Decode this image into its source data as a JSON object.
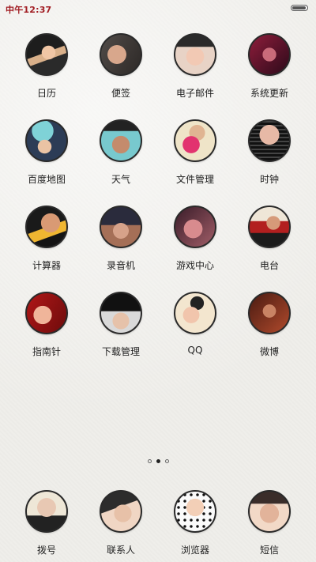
{
  "status_bar": {
    "time": "中午12:37",
    "battery_level": 1.0
  },
  "apps": [
    {
      "label": "日历",
      "icon": "calendar-avatar"
    },
    {
      "label": "便签",
      "icon": "notes-avatar"
    },
    {
      "label": "电子邮件",
      "icon": "email-avatar"
    },
    {
      "label": "系统更新",
      "icon": "system-update-avatar"
    },
    {
      "label": "百度地图",
      "icon": "baidu-map-avatar"
    },
    {
      "label": "天气",
      "icon": "weather-avatar"
    },
    {
      "label": "文件管理",
      "icon": "file-manager-avatar"
    },
    {
      "label": "时钟",
      "icon": "clock-avatar"
    },
    {
      "label": "计算器",
      "icon": "calculator-avatar"
    },
    {
      "label": "录音机",
      "icon": "recorder-avatar"
    },
    {
      "label": "游戏中心",
      "icon": "game-center-avatar"
    },
    {
      "label": "电台",
      "icon": "radio-avatar"
    },
    {
      "label": "指南针",
      "icon": "compass-avatar"
    },
    {
      "label": "下载管理",
      "icon": "download-manager-avatar"
    },
    {
      "label": "QQ",
      "icon": "qq-avatar"
    },
    {
      "label": "微博",
      "icon": "weibo-avatar"
    }
  ],
  "page_indicator": {
    "total_pages": 3,
    "current_page": 2
  },
  "dock": [
    {
      "label": "拨号",
      "icon": "dialer-avatar"
    },
    {
      "label": "联系人",
      "icon": "contacts-avatar"
    },
    {
      "label": "浏览器",
      "icon": "browser-avatar"
    },
    {
      "label": "短信",
      "icon": "messages-avatar"
    }
  ]
}
